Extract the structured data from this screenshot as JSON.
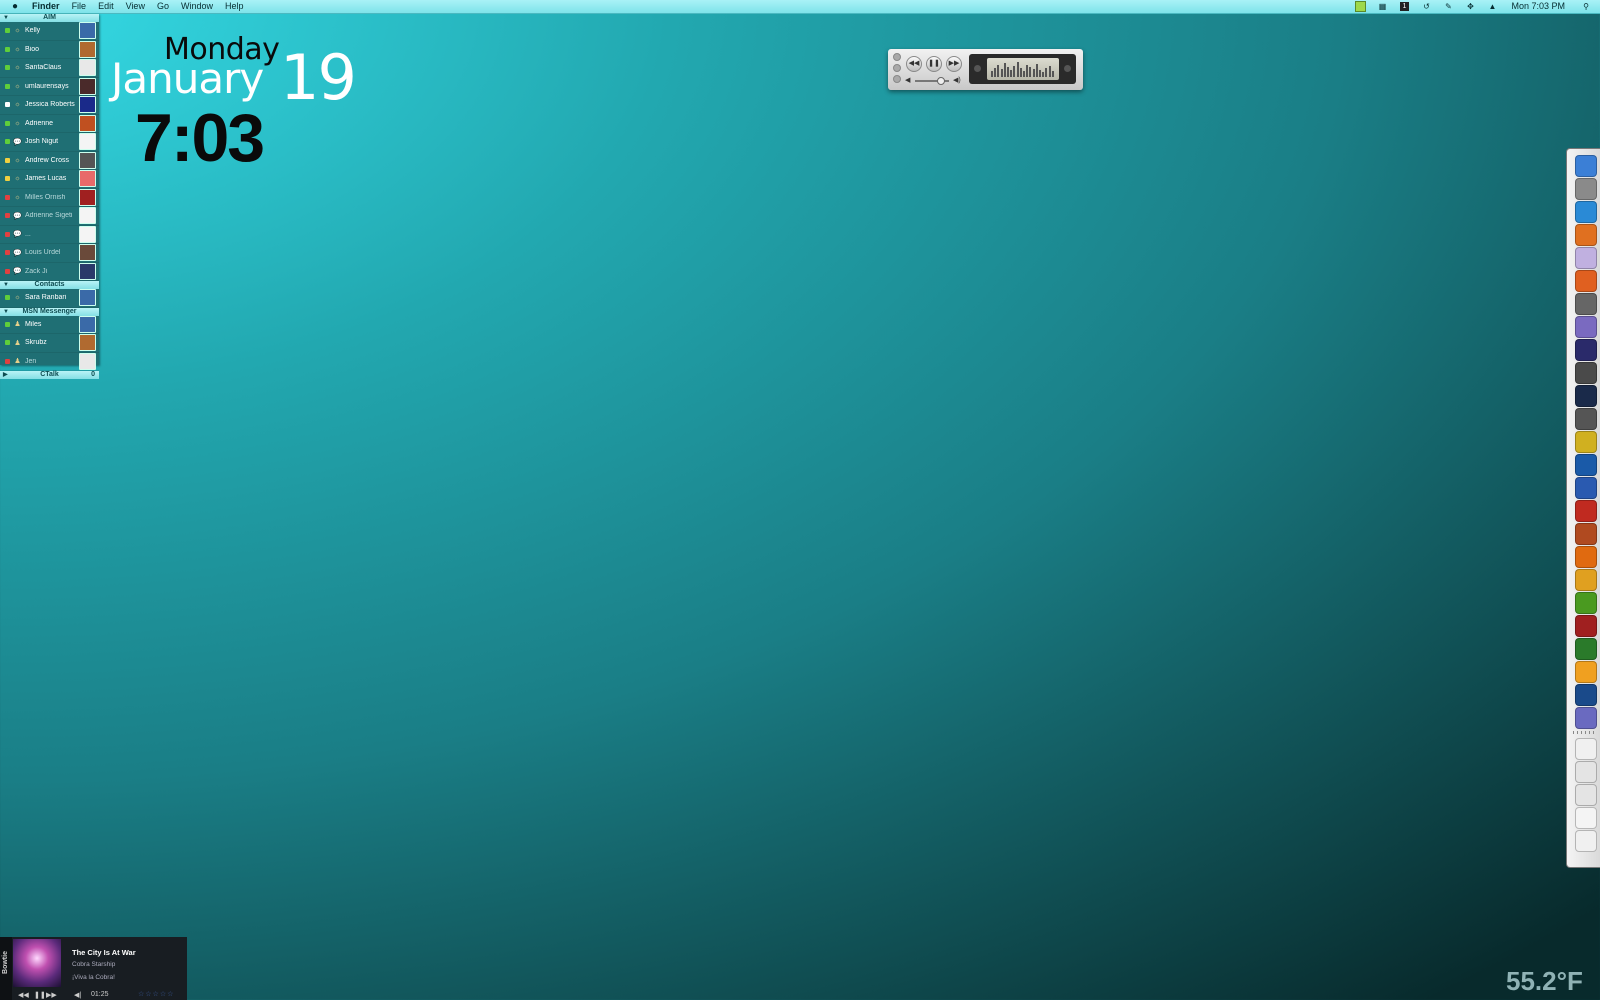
{
  "menubar": {
    "app_name": "Finder",
    "menus": [
      "File",
      "Edit",
      "View",
      "Go",
      "Window",
      "Help"
    ],
    "clock": "Mon 7:03 PM",
    "extras_icons": [
      "status-green-icon",
      "grid-icon",
      "numeric-1-icon",
      "time-machine-icon",
      "pen-icon",
      "move-icon",
      "volume-icon"
    ]
  },
  "buddy_list": {
    "groups": [
      {
        "name": "AIM",
        "buddies": [
          {
            "name": "Kelly",
            "status": "available"
          },
          {
            "name": "Bioo",
            "status": "available"
          },
          {
            "name": "SantaClaus",
            "status": "available"
          },
          {
            "name": "umlaurensays",
            "status": "available"
          },
          {
            "name": "Jessica Roberts",
            "status": "idle"
          },
          {
            "name": "Adrienne",
            "status": "available"
          },
          {
            "name": "Josh Nigut",
            "status": "available"
          },
          {
            "name": "Andrew Cross",
            "status": "away"
          },
          {
            "name": "James Lucas",
            "status": "away"
          },
          {
            "name": "Milles Ornish",
            "status": "offline"
          },
          {
            "name": "Adrienne Sigeti",
            "status": "offline"
          },
          {
            "name": "...",
            "status": "offline"
          },
          {
            "name": "Louis Urdel",
            "status": "offline"
          },
          {
            "name": "Zack Ji",
            "status": "offline"
          }
        ]
      },
      {
        "name": "Contacts",
        "buddies": [
          {
            "name": "Sara Ranbari",
            "status": "available"
          }
        ]
      },
      {
        "name": "MSN Messenger",
        "buddies": [
          {
            "name": "Miles",
            "status": "available"
          },
          {
            "name": "Skrubz",
            "status": "available"
          },
          {
            "name": "Jen",
            "status": "offline"
          }
        ]
      }
    ],
    "collapsed_group": {
      "name": "CTalk",
      "count": "0"
    }
  },
  "date_widget": {
    "day": "Monday",
    "month": "January",
    "date": "19",
    "time": "7:03"
  },
  "itunes": {
    "controls": [
      "rewind",
      "pause",
      "fast-forward"
    ]
  },
  "player": {
    "tab_label": "Bowtie",
    "track": "The City Is At War",
    "artist": "Cobra Starship",
    "album": "¡Viva la Cobra!",
    "elapsed": "01:25",
    "rating": "☆☆☆☆☆"
  },
  "weather": {
    "temperature": "55.2°F"
  },
  "colors": {
    "status_available": "#5fcf3a",
    "status_away": "#f0d040",
    "status_offline": "#e04040",
    "status_idle": "#ffffff",
    "dock_bg": "#e8e8e8"
  },
  "dock_icons": [
    "finder-icon",
    "webcam-icon",
    "safari-icon",
    "firefox-icon",
    "itunes-icon",
    "clock-icon",
    "photo-booth-icon",
    "preview-icon",
    "aperture-icon",
    "final-cut-icon",
    "time-machine-icon",
    "system-preferences-icon",
    "terminal-icon",
    "photoshop-icon",
    "contribute-icon",
    "flash-icon",
    "bridge-icon",
    "illustrator-icon",
    "fireworks-icon",
    "dreamweaver-icon",
    "acrobat-icon",
    "activity-monitor-icon",
    "garageband-icon",
    "quicktime-icon",
    "automator-icon",
    "documents-stack-icon",
    "folder-icon",
    "mail-folder-icon",
    "sfork-icon",
    "trash-icon"
  ]
}
